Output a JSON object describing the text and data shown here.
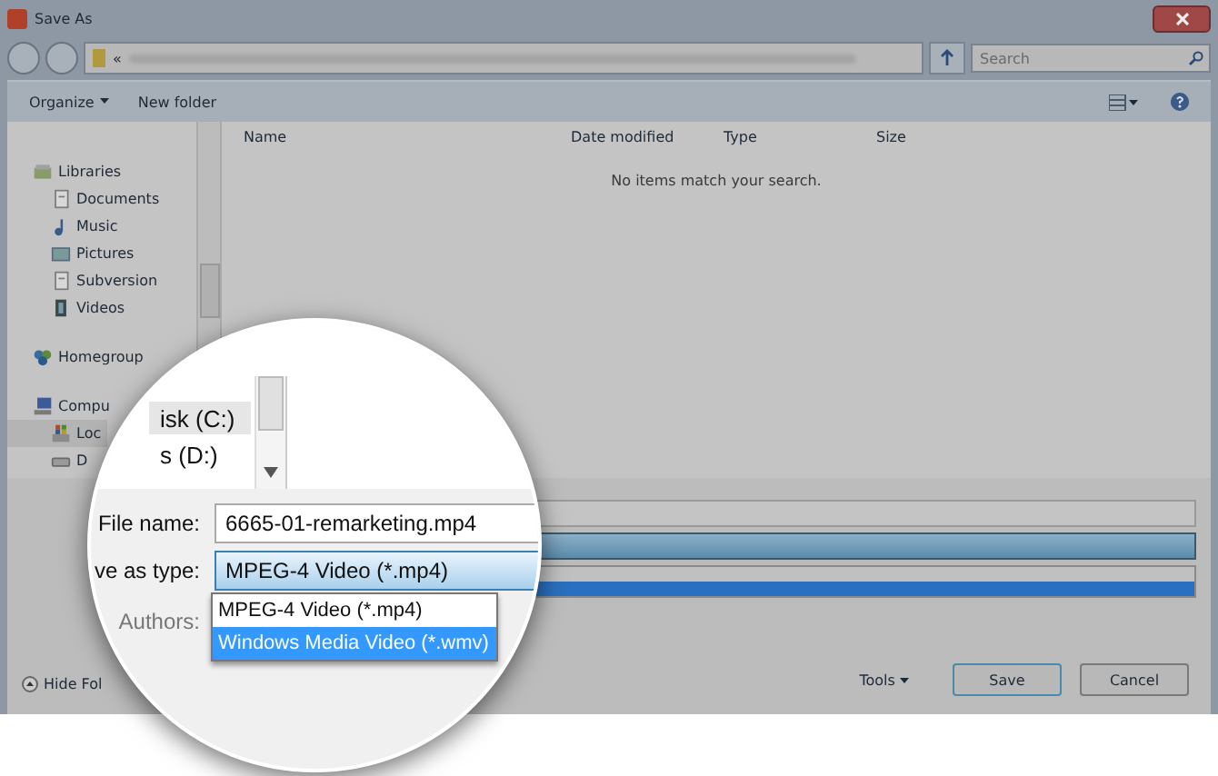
{
  "window": {
    "title": "Save As"
  },
  "address_bar": {
    "prefix": "«"
  },
  "search": {
    "placeholder": "Search"
  },
  "toolbar": {
    "buttons": [
      {
        "label": "Organize",
        "dropdown": true
      },
      {
        "label": "New folder",
        "dropdown": false
      }
    ]
  },
  "sidebar": {
    "items": [
      {
        "label": "Libraries",
        "kind": "library",
        "selected": false,
        "children": [
          {
            "label": "Documents",
            "kind": "documents",
            "selected": false
          },
          {
            "label": "Music",
            "kind": "music",
            "selected": false
          },
          {
            "label": "Pictures",
            "kind": "pictures",
            "selected": false
          },
          {
            "label": "Subversion",
            "kind": "documents",
            "selected": false
          },
          {
            "label": "Videos",
            "kind": "videos",
            "selected": false
          }
        ]
      },
      {
        "label": "Homegroup",
        "kind": "homegroup",
        "selected": false
      },
      {
        "label": "Compu",
        "kind": "computer",
        "selected": false,
        "children": [
          {
            "label": "Loc",
            "kind": "windows-drive",
            "selected": true
          },
          {
            "label": "D",
            "kind": "drive",
            "selected": false
          }
        ]
      }
    ]
  },
  "file_list": {
    "columns": [
      "Name",
      "Date modified",
      "Type",
      "Size"
    ],
    "empty_message": "No items match your search."
  },
  "lens": {
    "sidebar_items": [
      {
        "label": "isk (C:)",
        "selected": true
      },
      {
        "label": "s (D:)",
        "selected": false
      }
    ],
    "file_name": {
      "label": "File name:",
      "value": "6665-01-remarketing.mp4"
    },
    "save_as_type": {
      "label": "ve as type:",
      "value": "MPEG-4 Video (*.mp4)",
      "options": [
        {
          "label": "MPEG-4 Video (*.mp4)",
          "highlighted": false
        },
        {
          "label": "Windows Media Video (*.wmv)",
          "highlighted": true
        }
      ]
    },
    "authors": {
      "label": "Authors:"
    }
  },
  "footer": {
    "hide_folders": "Hide Fol",
    "tools": "Tools",
    "buttons": [
      {
        "label": "Save",
        "default": true
      },
      {
        "label": "Cancel",
        "default": false
      }
    ]
  }
}
